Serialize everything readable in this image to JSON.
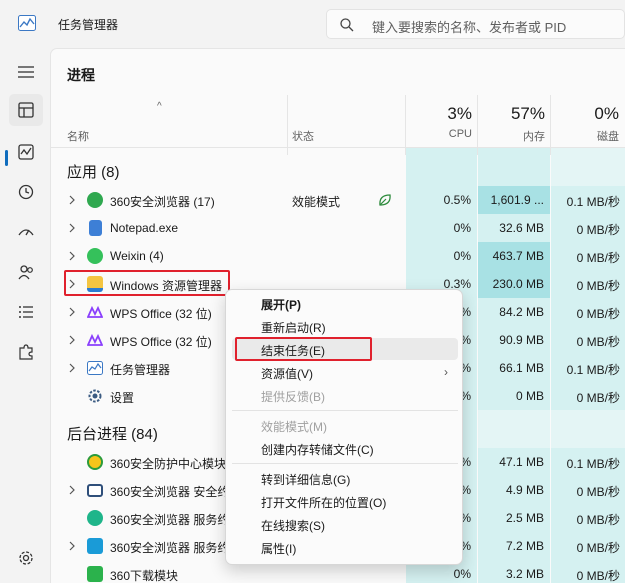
{
  "window": {
    "title": "任务管理器"
  },
  "search": {
    "placeholder": "键入要搜索的名称、发布者或 PID"
  },
  "page": {
    "title": "进程"
  },
  "columns": {
    "name": "名称",
    "status": "状态",
    "cpu_pct": "3%",
    "cpu_label": "CPU",
    "mem_pct": "57%",
    "mem_label": "内存",
    "disk_pct": "0%",
    "disk_label": "磁盘"
  },
  "groups": {
    "apps": "应用 (8)",
    "background": "后台进程 (84)"
  },
  "apps": [
    {
      "name": "360安全浏览器 (17)",
      "status": "效能模式",
      "cpu": "0.5%",
      "mem": "1,601.9 ...",
      "disk": "0.1 MB/秒",
      "icon": "360-browser-icon"
    },
    {
      "name": "Notepad.exe",
      "status": "",
      "cpu": "0%",
      "mem": "32.6 MB",
      "disk": "0 MB/秒",
      "icon": "notepad-icon"
    },
    {
      "name": "Weixin (4)",
      "status": "",
      "cpu": "0%",
      "mem": "463.7 MB",
      "disk": "0 MB/秒",
      "icon": "weixin-icon"
    },
    {
      "name": "Windows 资源管理器",
      "status": "",
      "cpu": "0.3%",
      "mem": "230.0 MB",
      "disk": "0 MB/秒",
      "icon": "folder-icon"
    },
    {
      "name": "WPS Office (32 位)",
      "status": "",
      "cpu": "%",
      "mem": "84.2 MB",
      "disk": "0 MB/秒",
      "icon": "wps-icon"
    },
    {
      "name": "WPS Office (32 位)",
      "status": "",
      "cpu": "%",
      "mem": "90.9 MB",
      "disk": "0 MB/秒",
      "icon": "wps-icon"
    },
    {
      "name": "任务管理器",
      "status": "",
      "cpu": "%",
      "mem": "66.1 MB",
      "disk": "0.1 MB/秒",
      "icon": "task-manager-icon"
    },
    {
      "name": "设置",
      "status": "",
      "cpu": "%",
      "mem": "0 MB",
      "disk": "0 MB/秒",
      "icon": "settings-gear-icon"
    }
  ],
  "background": [
    {
      "name": "360安全防护中心模块",
      "cpu": "%",
      "mem": "47.1 MB",
      "disk": "0.1 MB/秒",
      "icon": "360-guard-icon"
    },
    {
      "name": "360安全浏览器 安全约",
      "cpu": "%",
      "mem": "4.9 MB",
      "disk": "0 MB/秒",
      "icon": "360-browser-window-icon"
    },
    {
      "name": "360安全浏览器 服务约",
      "cpu": "%",
      "mem": "2.5 MB",
      "disk": "0 MB/秒",
      "icon": "360-service-icon"
    },
    {
      "name": "360安全浏览器 服务约",
      "cpu": "%",
      "mem": "7.2 MB",
      "disk": "0 MB/秒",
      "icon": "360-service2-icon"
    },
    {
      "name": "360下载模块",
      "cpu": "0%",
      "mem": "3.2 MB",
      "disk": "0 MB/秒",
      "icon": "360-download-icon"
    }
  ],
  "context_menu": {
    "expand": "展开(P)",
    "restart": "重新启动(R)",
    "end_task": "结束任务(E)",
    "resource_values": "资源值(V)",
    "feedback": "提供反馈(B)",
    "efficiency": "效能模式(M)",
    "dump": "创建内存转储文件(C)",
    "details": "转到详细信息(G)",
    "open_location": "打开文件所在的位置(O)",
    "search_online": "在线搜索(S)",
    "properties": "属性(I)"
  },
  "colors": {
    "accent": "#0f6cbd",
    "heat_light": "#d5f1f1",
    "heat_dark": "#a8e1e4",
    "annotation": "#e0212d"
  }
}
